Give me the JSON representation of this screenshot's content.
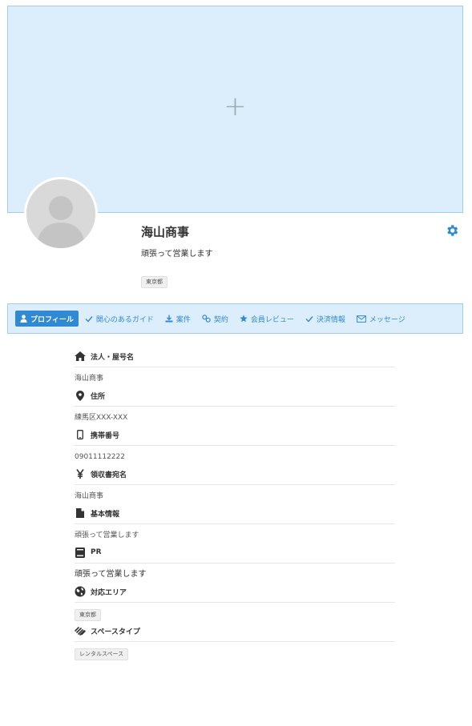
{
  "cover": {
    "plus_glyph": "+"
  },
  "profile": {
    "name": "海山商事",
    "tagline": "頑張って営業します",
    "area_chip": "東京都"
  },
  "colors": {
    "accent": "#2f8ad3",
    "cover_bg": "#dceefc",
    "border": "#9ecdf0"
  },
  "tabs": [
    {
      "label": "プロフィール",
      "icon": "person-icon",
      "active": true
    },
    {
      "label": "関心のあるガイド",
      "icon": "check-icon",
      "active": false
    },
    {
      "label": "案件",
      "icon": "download-icon",
      "active": false
    },
    {
      "label": "契約",
      "icon": "link-icon",
      "active": false
    },
    {
      "label": "会員レビュー",
      "icon": "star-icon",
      "active": false
    },
    {
      "label": "決済情報",
      "icon": "check-icon",
      "active": false
    },
    {
      "label": "メッセージ",
      "icon": "envelope-icon",
      "active": false
    }
  ],
  "sections": {
    "company": {
      "label": "法人・屋号名",
      "value": "海山商事",
      "icon": "home-icon"
    },
    "address": {
      "label": "住所",
      "value": "練馬区XXX-XXX",
      "icon": "map-pin-icon"
    },
    "phone": {
      "label": "携帯番号",
      "value": "09011112222",
      "icon": "mobile-icon"
    },
    "receipt": {
      "label": "領収書宛名",
      "value": "海山商事",
      "icon": "yen-icon"
    },
    "basic": {
      "label": "基本情報",
      "value": "頑張って営業します",
      "icon": "document-icon"
    },
    "pr": {
      "label": "PR",
      "value": "頑張って営業します",
      "icon": "book-icon"
    },
    "area": {
      "label": "対応エリア",
      "value": "東京都",
      "icon": "globe-icon"
    },
    "space": {
      "label": "スペースタイプ",
      "value": "レンタルスペース",
      "icon": "squarespace-icon"
    }
  }
}
